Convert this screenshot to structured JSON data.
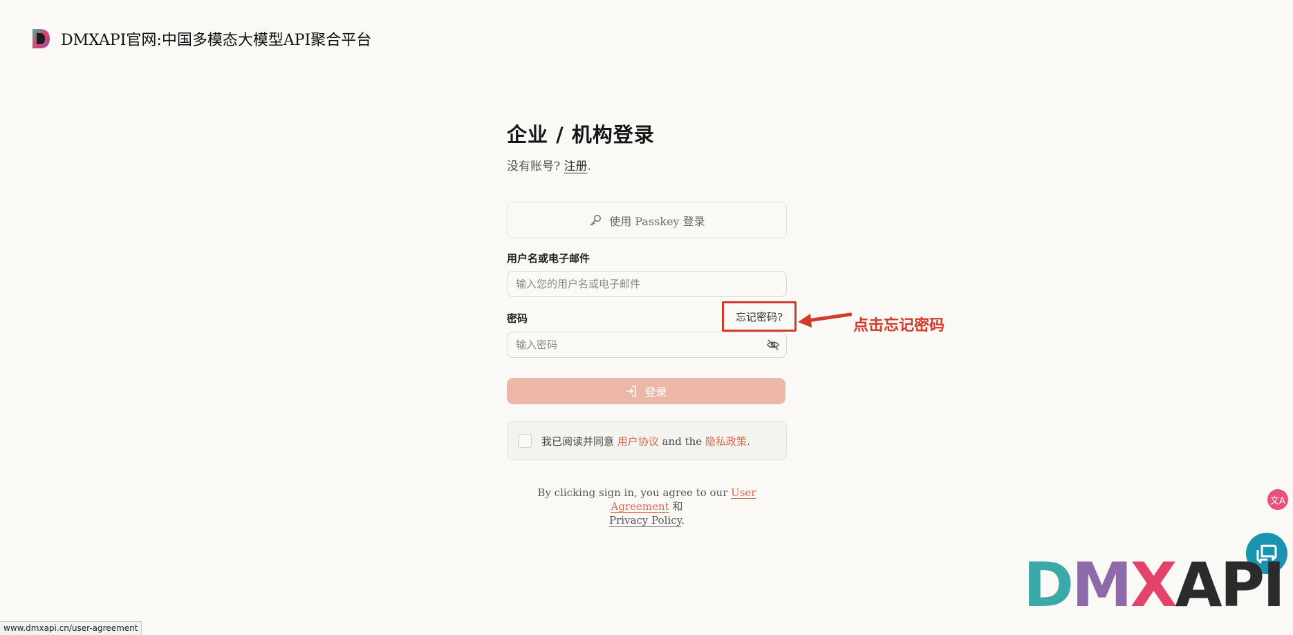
{
  "header": {
    "brand": "DMXAPI官网:中国多模态大模型API聚合平台",
    "logo_icon": "dmxapi-d-logo-icon"
  },
  "login": {
    "title": "企业 / 机构登录",
    "subtitle_prefix": "没有账号?",
    "register_link": "注册",
    "subtitle_suffix": ".",
    "passkey_label": "使用 Passkey 登录",
    "username_label": "用户名或电子邮件",
    "username_placeholder": "输入您的用户名或电子邮件",
    "password_label": "密码",
    "forgot_label": "忘记密码?",
    "password_placeholder": "输入密码",
    "login_label": "登录",
    "agree_prefix": "我已阅读并同意",
    "agree_terms": "用户协议",
    "agree_mid": "and the",
    "agree_privacy": "隐私政策",
    "agree_suffix": ".",
    "disclaimer_prefix": "By clicking sign in, you agree to our",
    "disclaimer_user_agreement": "User Agreement",
    "disclaimer_and": "和",
    "disclaimer_privacy": "Privacy Policy",
    "disclaimer_suffix": "."
  },
  "annotation": {
    "text": "点击忘记密码",
    "color": "#d23a2a"
  },
  "widgets": {
    "translate_glyph": "文A"
  },
  "watermark": {
    "letters": [
      "D",
      "M",
      "X",
      "A",
      "P",
      "I"
    ],
    "colors": [
      "#3aa9a8",
      "#3aa9a8",
      "#c7457a",
      "#e2436a",
      "#2b2b2b",
      "#2b2b2b"
    ]
  },
  "statusbar": {
    "url": "www.dmxapi.cn/user-agreement"
  },
  "colors": {
    "accent": "#d96a4c",
    "button_disabled": "#ecb7a6",
    "background": "#faf9f5"
  }
}
